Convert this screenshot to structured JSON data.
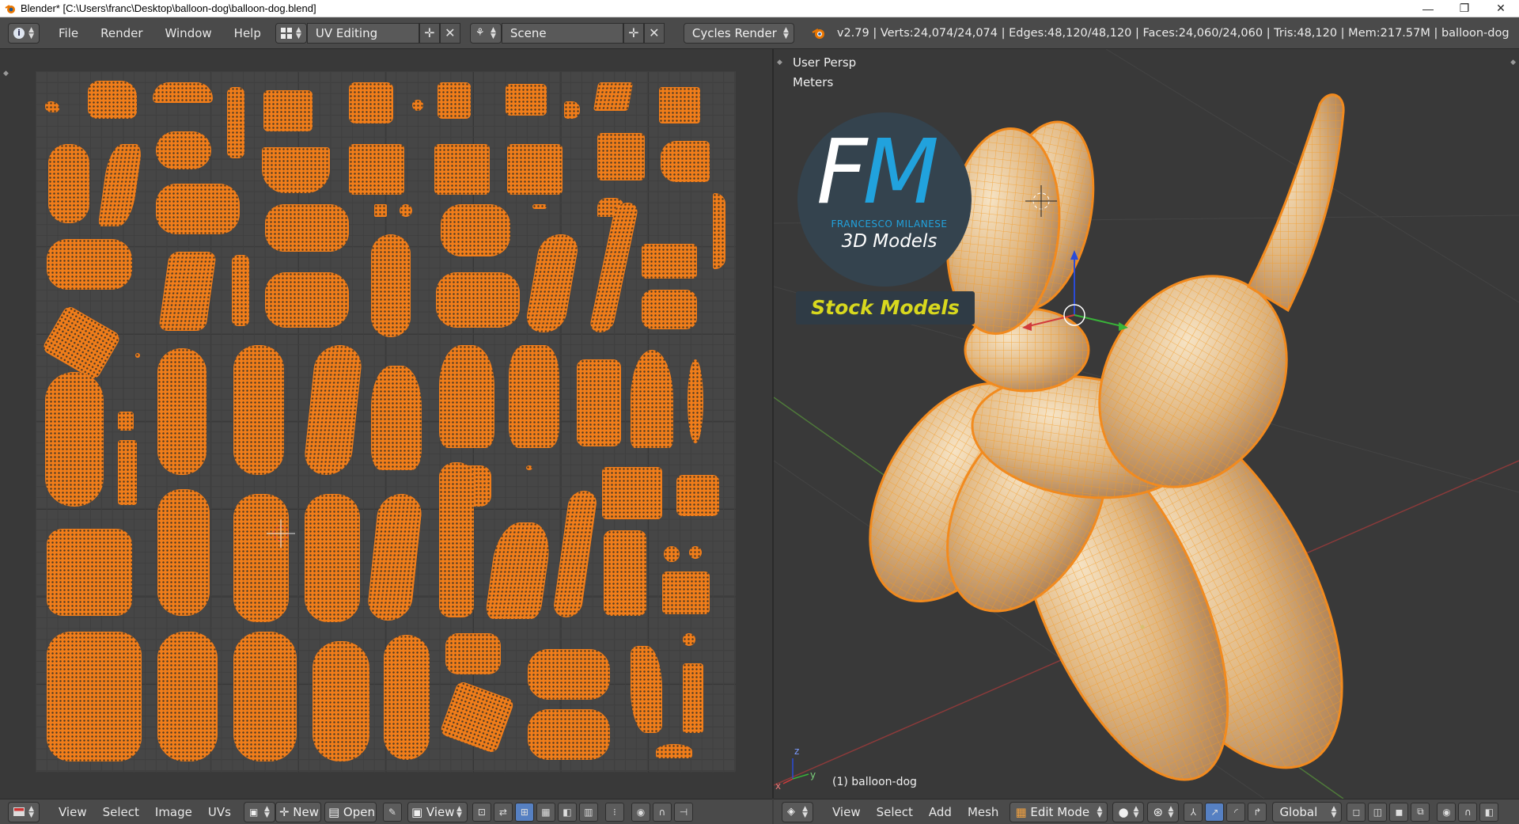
{
  "window": {
    "title": "Blender* [C:\\Users\\franc\\Desktop\\balloon-dog\\balloon-dog.blend]",
    "minimize": "—",
    "maximize": "❐",
    "close": "✕"
  },
  "topbar": {
    "menus": [
      "File",
      "Render",
      "Window",
      "Help"
    ],
    "screen_layout": "UV Editing",
    "scene": "Scene",
    "render_engine": "Cycles Render",
    "stats": "v2.79 | Verts:24,074/24,074 | Edges:48,120/48,120 | Faces:24,060/24,060 | Tris:48,120 | Mem:217.57M | balloon-dog"
  },
  "viewport": {
    "view_name": "User Persp",
    "units": "Meters",
    "object_label": "(1) balloon-dog",
    "logo": {
      "monogram_f": "F",
      "monogram_m": "M",
      "author": "FRANCESCO MILANESE",
      "subtitle": "3D Models",
      "banner": "Stock Models"
    },
    "axis_x": "x",
    "axis_y": "y",
    "axis_z": "z"
  },
  "uv_footer": {
    "menus": [
      "View",
      "Select",
      "Image",
      "UVs"
    ],
    "new_label": "New",
    "open_label": "Open",
    "view_label": "View"
  },
  "viewport_footer": {
    "menus": [
      "View",
      "Select",
      "Add",
      "Mesh"
    ],
    "mode": "Edit Mode",
    "orientation": "Global"
  },
  "colors": {
    "uv_orange": "#f07d1a",
    "bg_panel": "#393939",
    "accent_blue": "#1e9ad6",
    "stock_yellow": "#d8d81e"
  }
}
